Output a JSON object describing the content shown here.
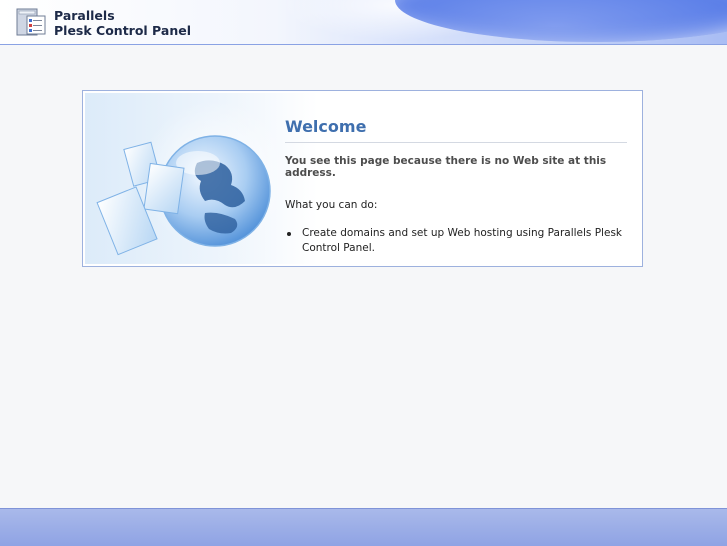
{
  "header": {
    "brand_line1": "Parallels",
    "brand_line2": "Plesk Control Panel",
    "logo_icon": "server-panel-icon"
  },
  "welcome": {
    "title": "Welcome",
    "reason": "You see this page because there is no Web site at this address.",
    "what_you_can_do": "What you can do:",
    "options": [
      "Create domains and set up Web hosting using Parallels Plesk Control Panel."
    ],
    "illustration_icon": "globe-documents-icon"
  },
  "colors": {
    "title": "#3f6fae",
    "panel_border": "#9db1de",
    "header_accent": "#5b7fe8",
    "footer": "#8fa3e4"
  }
}
